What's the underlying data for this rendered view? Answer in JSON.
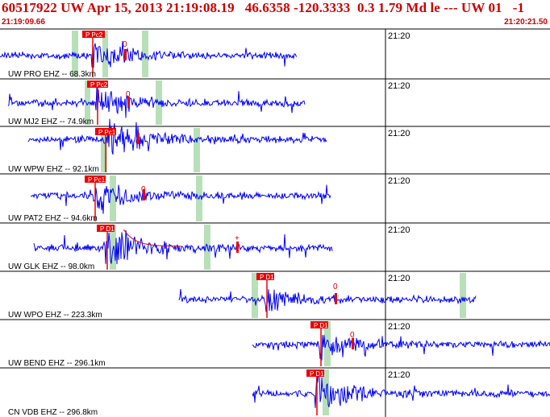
{
  "header": {
    "title": "60517922 UW Apr 15, 2013 21:19:08.19   46.6358 -120.3333  0.3 1.79 Md le --- UW 01   -1",
    "start_time": "21:19:09.66",
    "end_time": "21:20:21.50"
  },
  "colors": {
    "trace": "#0000ff",
    "pick": "#ee0000",
    "window": "#b8e0b8",
    "header_text": "#cc0000",
    "minute_line": "#000000"
  },
  "panels": [
    {
      "label": "UW PRO EHZ -- 68.3km",
      "time_mark": "21:20",
      "pick_label": "P Pc2",
      "coda_label": "0",
      "end_label": ""
    },
    {
      "label": "UW MJ2 EHZ -- 74.9km",
      "time_mark": "21:20",
      "pick_label": "P Pc2",
      "coda_label": "0",
      "end_label": ""
    },
    {
      "label": "UW WPW EHZ -- 92.1km",
      "time_mark": "21:20",
      "pick_label": "P Pc1",
      "coda_label": "0",
      "end_label": ""
    },
    {
      "label": "UW PAT2 EHZ -- 94.6km",
      "time_mark": "21:20",
      "pick_label": "P Pc1",
      "coda_label": "0",
      "end_label": ""
    },
    {
      "label": "UW GLK EHZ -- 98.0km",
      "time_mark": "21:20",
      "pick_label": "P D1",
      "coda_label": "",
      "end_label": "+"
    },
    {
      "label": "UW WPO EHZ -- 223.3km",
      "time_mark": "21:20",
      "pick_label": "P D1",
      "coda_label": "0",
      "end_label": ""
    },
    {
      "label": "UW BEND EHZ -- 296.1km",
      "time_mark": "21:20",
      "pick_label": "P D1",
      "coda_label": "0",
      "end_label": ""
    },
    {
      "label": "CN VDB EHZ -- 296.8km",
      "time_mark": "21:20",
      "pick_label": "P D1",
      "coda_label": "",
      "end_label": ""
    }
  ]
}
